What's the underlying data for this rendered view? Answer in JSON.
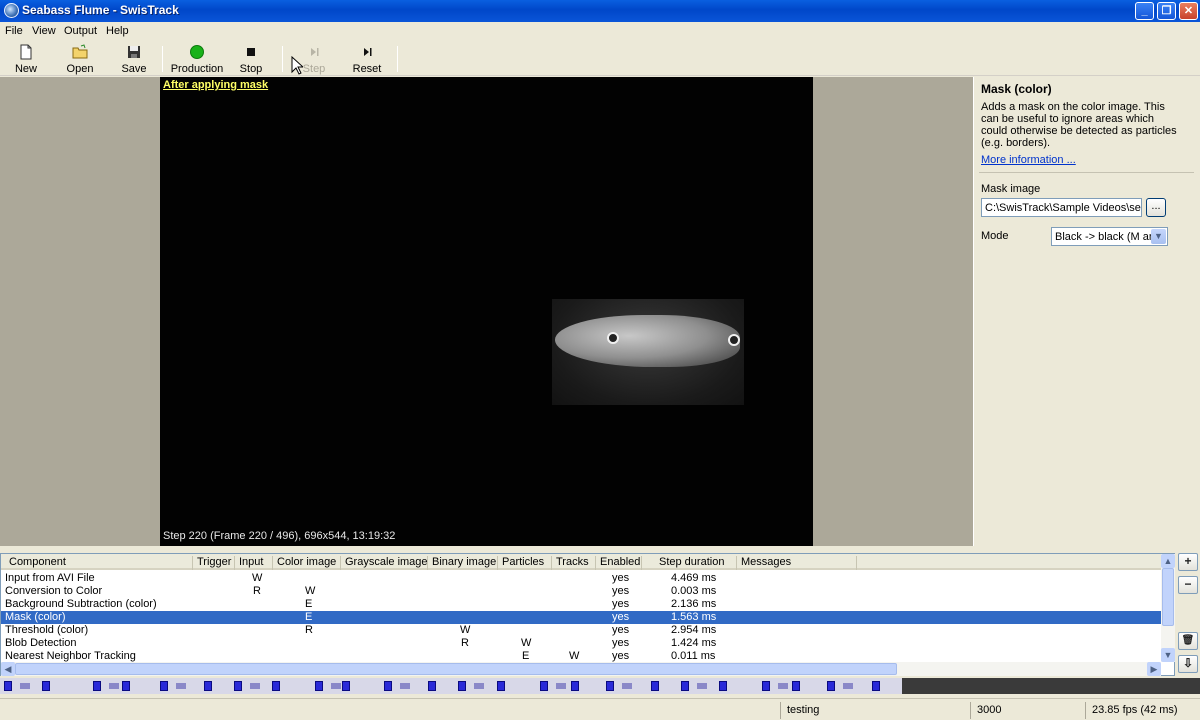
{
  "window": {
    "title": "Seabass Flume - SwisTrack",
    "minimize": "_",
    "maximize": "❐",
    "close": "✕"
  },
  "menu": [
    "File",
    "View",
    "Output",
    "Help"
  ],
  "toolbar": {
    "new": "New",
    "open": "Open",
    "save": "Save",
    "production": "Production",
    "stop": "Stop",
    "step": "Step",
    "reset": "Reset",
    "production_color": "#19b219"
  },
  "video": {
    "caption": "After applying mask",
    "status": "Step 220 (Frame 220 / 496), 696x544, 13:19:32"
  },
  "panel": {
    "title": "Mask (color)",
    "description": "Adds a mask on the color image. This can be useful to ignore areas which could otherwise be detected as particles (e.g. borders).",
    "more_info": "More information ...",
    "mask_image_label": "Mask image",
    "mask_image_value": "C:\\SwisTrack\\Sample Videos\\seaba",
    "browse": "...",
    "mode_label": "Mode",
    "mode_value": "Black -> black (M and"
  },
  "components": {
    "columns": [
      "Component",
      "Trigger",
      "Input",
      "Color image",
      "Grayscale image",
      "Binary image",
      "Particles",
      "Tracks",
      "Enabled",
      "Step duration",
      "Messages"
    ],
    "rows": [
      {
        "name": "Input from AVI File",
        "trigger": "",
        "input": "W",
        "color": "",
        "gray": "",
        "binary": "",
        "particles": "",
        "tracks": "",
        "enabled": "yes",
        "duration": "4.469 ms"
      },
      {
        "name": "Conversion to Color",
        "trigger": "",
        "input": "R",
        "color": "W",
        "gray": "",
        "binary": "",
        "particles": "",
        "tracks": "",
        "enabled": "yes",
        "duration": "0.003 ms"
      },
      {
        "name": "Background Subtraction (color)",
        "trigger": "",
        "input": "",
        "color": "E",
        "gray": "",
        "binary": "",
        "particles": "",
        "tracks": "",
        "enabled": "yes",
        "duration": "2.136 ms"
      },
      {
        "name": "Mask (color)",
        "trigger": "",
        "input": "",
        "color": "E",
        "gray": "",
        "binary": "",
        "particles": "",
        "tracks": "",
        "enabled": "yes",
        "duration": "1.563 ms"
      },
      {
        "name": "Threshold (color)",
        "trigger": "",
        "input": "",
        "color": "R",
        "gray": "",
        "binary": "W",
        "particles": "",
        "tracks": "",
        "enabled": "yes",
        "duration": "2.954 ms"
      },
      {
        "name": "Blob Detection",
        "trigger": "",
        "input": "",
        "color": "",
        "gray": "",
        "binary": "R",
        "particles": "W",
        "tracks": "",
        "enabled": "yes",
        "duration": "1.424 ms"
      },
      {
        "name": "Nearest Neighbor Tracking",
        "trigger": "",
        "input": "",
        "color": "",
        "gray": "",
        "binary": "",
        "particles": "E",
        "tracks": "W",
        "enabled": "yes",
        "duration": "0.011 ms"
      }
    ],
    "selected_row": 3
  },
  "side_buttons": {
    "add": "+",
    "remove": "−",
    "trash": "🗑",
    "down": "⇩"
  },
  "statusbar": {
    "mode": "testing",
    "frames": "3000",
    "fps": "23.85 fps (42 ms)"
  }
}
